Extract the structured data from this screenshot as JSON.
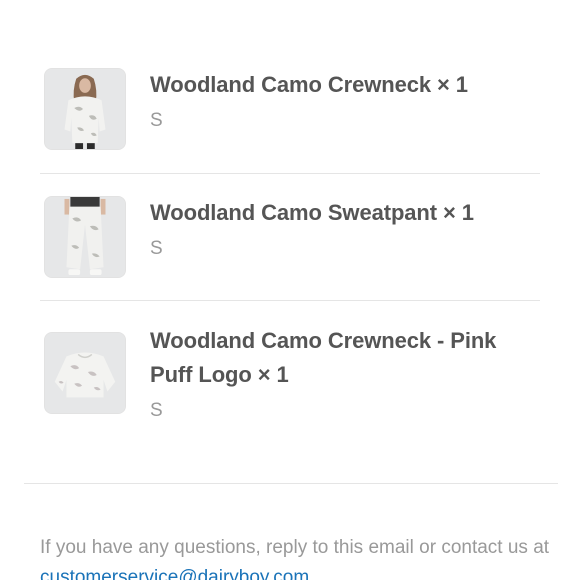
{
  "items": [
    {
      "title": "Woodland Camo Crewneck × 1",
      "variant": "S",
      "image_icon": "product-photo-model-crewneck"
    },
    {
      "title": "Woodland Camo Sweatpant × 1",
      "variant": "S",
      "image_icon": "product-photo-model-sweatpant"
    },
    {
      "title": "Woodland Camo Crewneck - Pink Puff Logo × 1",
      "variant": "S",
      "image_icon": "product-photo-flat-crewneck"
    }
  ],
  "footer": {
    "text": "If you have any questions, reply to this email or contact us at ",
    "email_link": "customerservice@dairyboy.com"
  },
  "colors": {
    "title": "#555555",
    "muted": "#999999",
    "link": "#1a73b8",
    "divider": "#e5e5e5"
  }
}
